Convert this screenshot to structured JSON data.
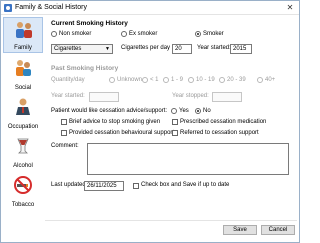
{
  "window": {
    "title": "Family & Social History",
    "close_glyph": "✕"
  },
  "sidebar": {
    "items": [
      {
        "label": "Family",
        "icon": "family-icon"
      },
      {
        "label": "Social",
        "icon": "social-icon"
      },
      {
        "label": "Occupation",
        "icon": "occupation-icon"
      },
      {
        "label": "Alcohol",
        "icon": "alcohol-icon"
      },
      {
        "label": "Tobacco",
        "icon": "tobacco-icon"
      }
    ]
  },
  "current": {
    "heading": "Current Smoking History",
    "options": [
      "Non smoker",
      "Ex smoker",
      "Smoker"
    ],
    "selected": "Smoker",
    "product": "Cigarettes",
    "per_day_label": "Cigarettes per day",
    "per_day_value": "20",
    "year_started_label": "Year started:",
    "year_started_value": "2015"
  },
  "past": {
    "heading": "Past Smoking History",
    "quantity_label": "Quantity/day",
    "quantity_options": [
      "Unknown",
      "< 1",
      "1 - 9",
      "10 - 19",
      "20 - 39",
      "40+"
    ],
    "year_started_label": "Year started:",
    "year_stopped_label": "Year stopped:"
  },
  "cessation": {
    "question": "Patient would like cessation advice/support:",
    "yes_label": "Yes",
    "no_label": "No",
    "selected": "No",
    "checks": [
      "Brief advice to stop smoking given",
      "Prescribed cessation medication",
      "Provided cessation behavioural support",
      "Referred to cessation support"
    ]
  },
  "comment": {
    "label": "Comment:",
    "value": ""
  },
  "footer": {
    "last_updated_label": "Last updated:",
    "last_updated_value": "26/11/2025",
    "save_check_label": "Check box and Save if up to date",
    "save_button": "Save",
    "cancel_button": "Cancel"
  },
  "colors": {
    "active_nav": "#dbe8f7",
    "accent": "#3a73c4",
    "disabled_text": "#9a9a9a"
  }
}
